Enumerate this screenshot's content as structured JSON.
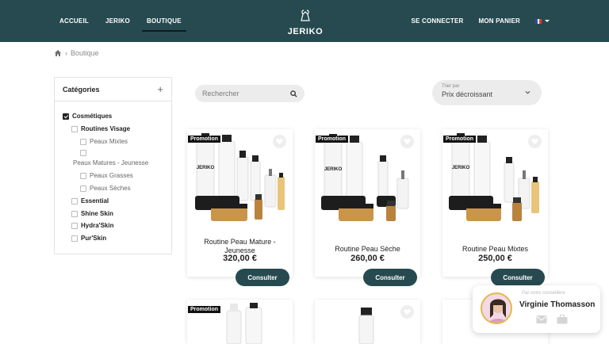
{
  "nav": {
    "left": [
      "ACCUEIL",
      "JERIKO",
      "BOUTIQUE"
    ],
    "active": "BOUTIQUE",
    "logo_text": "JERIKO",
    "login": "SE CONNECTER",
    "cart": "MON PANIER"
  },
  "breadcrumb": {
    "current": "Boutique"
  },
  "sidebar": {
    "title": "Catégories",
    "items": [
      {
        "label": "Cosmétiques",
        "checked": true
      },
      {
        "label": "Routines Visage",
        "checked": false
      },
      {
        "label": "Peaux Mixtes",
        "checked": false
      },
      {
        "label": "Peaux Matures - Jeunesse",
        "checked": false
      },
      {
        "label": "Peaux Grasses",
        "checked": false
      },
      {
        "label": "Peaux Sèches",
        "checked": false
      },
      {
        "label": "Essential",
        "checked": false
      },
      {
        "label": "Shine Skin",
        "checked": false
      },
      {
        "label": "Hydra'Skin",
        "checked": false
      },
      {
        "label": "Pur'Skin",
        "checked": false
      }
    ]
  },
  "search": {
    "placeholder": "Rechercher"
  },
  "sort": {
    "label": "Trier par",
    "value": "Prix décroissant"
  },
  "products": [
    {
      "badge": "Promotion",
      "name": "Routine Peau Mature - Jeunesse",
      "price": "320,00 €",
      "cta": "Consulter"
    },
    {
      "badge": "Promotion",
      "name": "Routine Peau Sèche",
      "price": "260,00 €",
      "cta": "Consulter"
    },
    {
      "badge": "Promotion",
      "name": "Routine Peau Mixtes",
      "price": "250,00 €",
      "cta": "Consulter"
    }
  ],
  "second_row": [
    {
      "badge": "Promotion"
    }
  ],
  "contact": {
    "label": "Par votre conseillère",
    "name": "Virginie Thomasson"
  },
  "colors": {
    "header": "#264a50",
    "button": "#264a50",
    "badge": "#111111"
  }
}
